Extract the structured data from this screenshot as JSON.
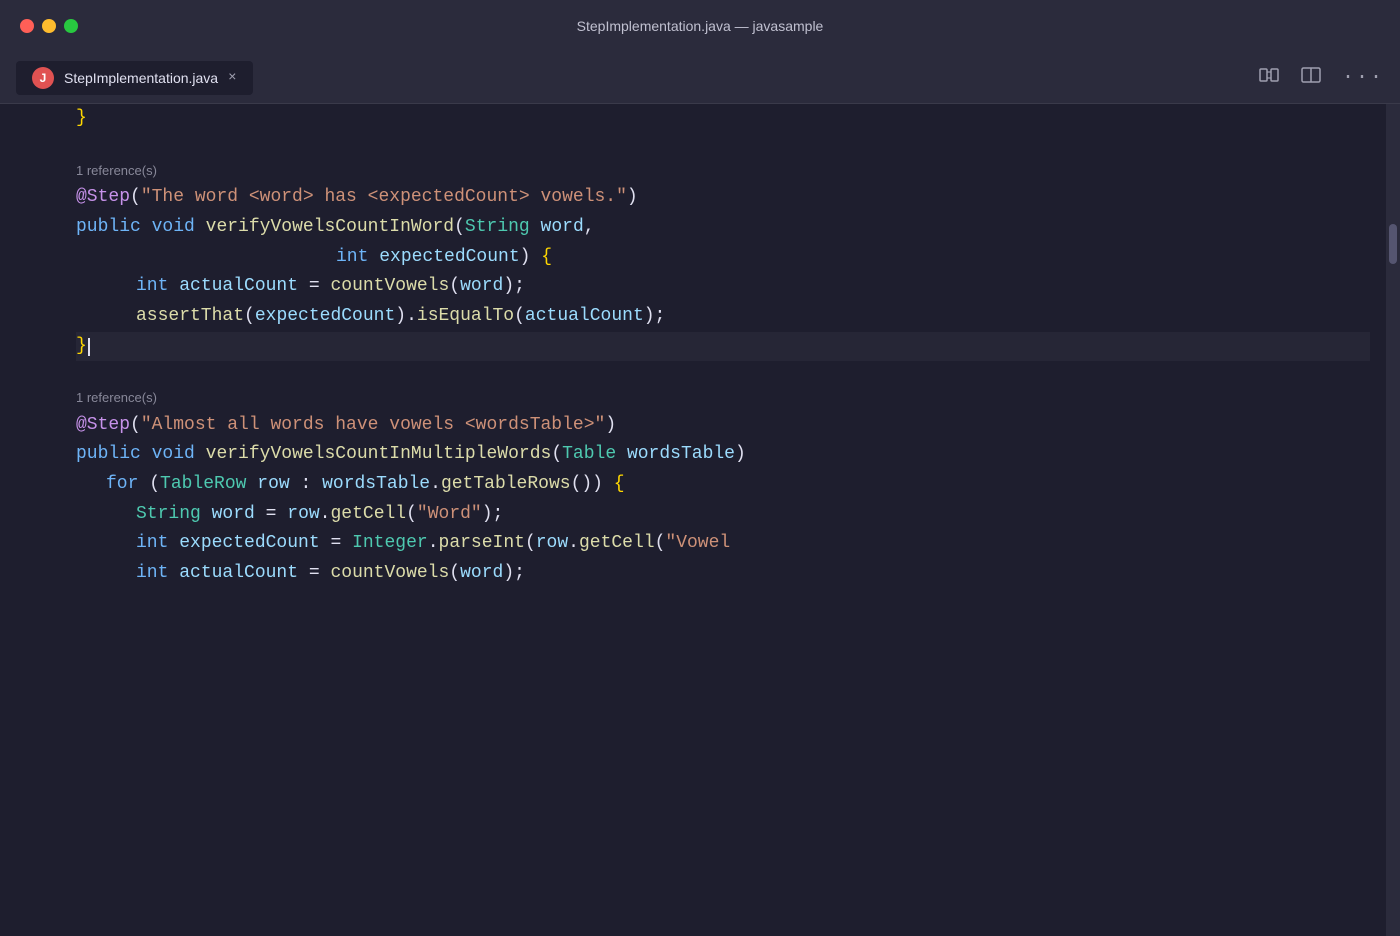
{
  "window": {
    "title": "StepImplementation.java — javasample",
    "traffic_lights": [
      "red",
      "yellow",
      "green"
    ]
  },
  "tab": {
    "icon_label": "J",
    "filename": "StepImplementation.java",
    "close_label": "×"
  },
  "toolbar": {
    "diff_icon": "⇄",
    "split_icon": "⬜",
    "more_icon": "···"
  },
  "code": {
    "reference1": "1 reference(s)",
    "reference2": "1 reference(s)",
    "lines": [
      {
        "num": "",
        "content": "}"
      },
      {
        "num": "",
        "content": ""
      },
      {
        "num": "",
        "content": "1 reference(s)"
      },
      {
        "num": "",
        "content": "@Step(\"The word <word> has <expectedCount> vowels.\")"
      },
      {
        "num": "",
        "content": "public void verifyVowelsCountInWord(String word,"
      },
      {
        "num": "",
        "content": "                                    int expectedCount) {"
      },
      {
        "num": "",
        "content": "    int actualCount = countVowels(word);"
      },
      {
        "num": "",
        "content": "    assertThat(expectedCount).isEqualTo(actualCount);"
      },
      {
        "num": "",
        "content": "}"
      },
      {
        "num": "",
        "content": ""
      },
      {
        "num": "",
        "content": "1 reference(s)"
      },
      {
        "num": "",
        "content": "@Step(\"Almost all words have vowels <wordsTable>\")"
      },
      {
        "num": "",
        "content": "public void verifyVowelsCountInMultipleWords(Table wordsTable)"
      },
      {
        "num": "",
        "content": "    for (TableRow row : wordsTable.getTableRows()) {"
      },
      {
        "num": "",
        "content": "        String word = row.getCell(\"Word\");"
      },
      {
        "num": "",
        "content": "        int expectedCount = Integer.parseInt(row.getCell(\"Vowel"
      },
      {
        "num": "",
        "content": "        int actualCount = countVowels(word);"
      }
    ]
  }
}
